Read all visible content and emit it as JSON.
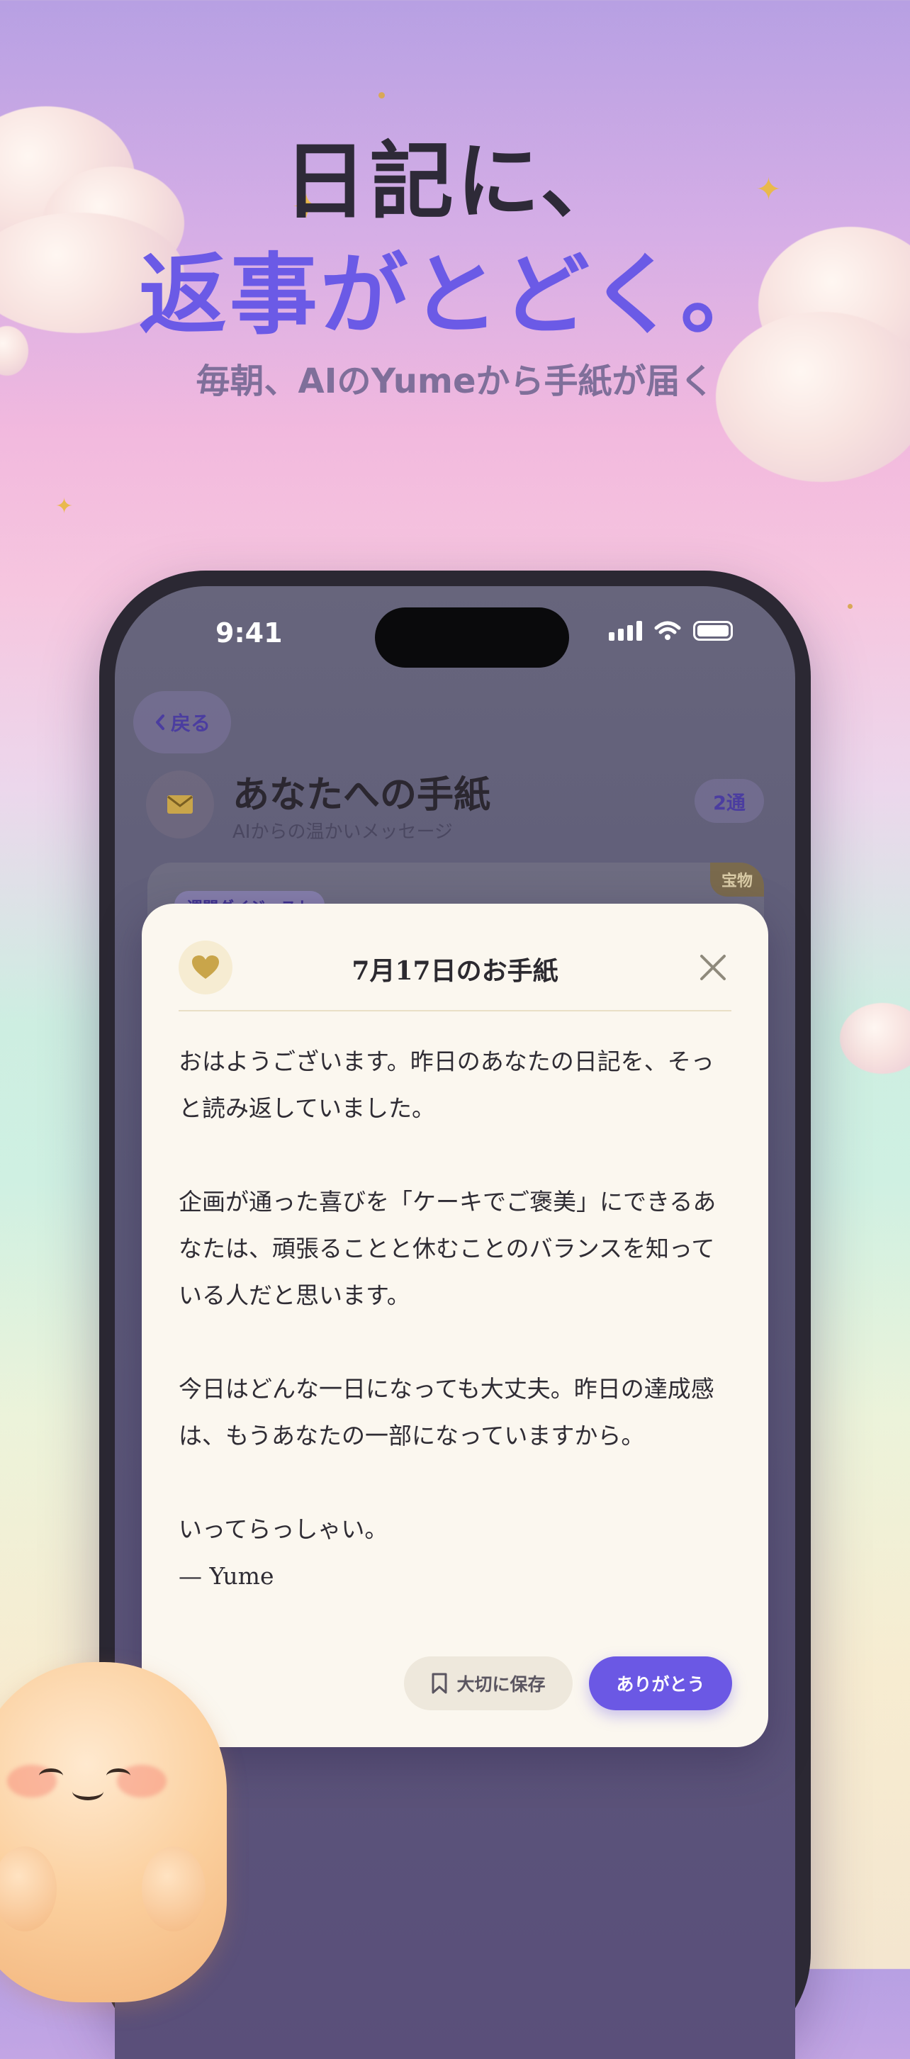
{
  "hero": {
    "line1": "日記に、",
    "line2": "返事がとどく。",
    "subtitle": "毎朝、AIのYumeから手紙が届く"
  },
  "status_bar": {
    "time": "9:41"
  },
  "screen": {
    "back_label": "戻る",
    "title": "あなたへの手紙",
    "subtitle": "AIからの温かいメッセージ",
    "count_badge": "2通",
    "card_tag": "週間ダイジェスト",
    "card_badge": "宝物"
  },
  "modal": {
    "title": "7月17日のお手紙",
    "paragraphs": [
      "おはようございます。昨日のあなたの日記を、そっと読み返していました。",
      "企画が通った喜びを「ケーキでご褒美」にできるあなたは、頑張ることと休むことのバランスを知っている人だと思います。",
      "今日はどんな一日になっても大丈夫。昨日の達成感は、もうあなたの一部になっていますから。"
    ],
    "closing": "いってらっしゃい。",
    "signature": "— Yume",
    "save_label": "大切に保存",
    "thanks_label": "ありがとう"
  },
  "colors": {
    "accent": "#6b58e4",
    "headline_dark": "#2e2a38",
    "gold": "#c9a54a"
  },
  "icons": [
    "chevron-left-icon",
    "envelope-icon",
    "heart-icon",
    "close-icon",
    "bookmark-icon",
    "signal-icon",
    "wifi-icon",
    "battery-icon",
    "sparkle-icon"
  ]
}
